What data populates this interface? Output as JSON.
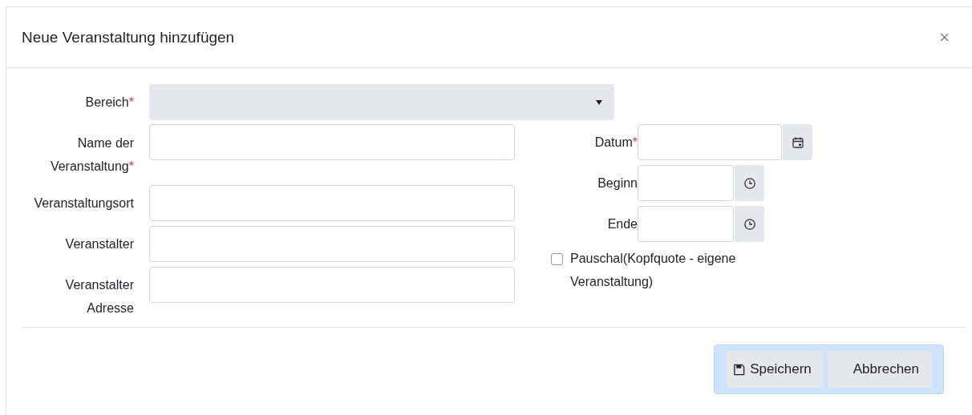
{
  "dialog": {
    "title": "Neue Veranstaltung hinzufügen",
    "close": "×"
  },
  "left_fields": [
    {
      "label": "Bereich",
      "required_mark": "*",
      "kind": "select"
    },
    {
      "label": "Name der Veranstaltung",
      "required_mark": "*",
      "kind": "text"
    },
    {
      "label": "Veranstaltungsort",
      "kind": "text"
    },
    {
      "label": "Veranstalter",
      "kind": "text"
    },
    {
      "label": "Veranstalter Adresse",
      "kind": "text"
    }
  ],
  "right_fields": [
    {
      "label": "Datum",
      "required_mark": "*",
      "kind": "date"
    },
    {
      "label": "Beginn",
      "kind": "time"
    },
    {
      "label": "Ende",
      "kind": "time"
    }
  ],
  "pauschal": {
    "label": "Pauschal(Kopfquote - eigene Veranstaltung)",
    "checked": false
  },
  "buttons": [
    {
      "label": "Speichern",
      "kind": "save"
    },
    {
      "label": "Abbrechen",
      "kind": "cancel"
    }
  ]
}
